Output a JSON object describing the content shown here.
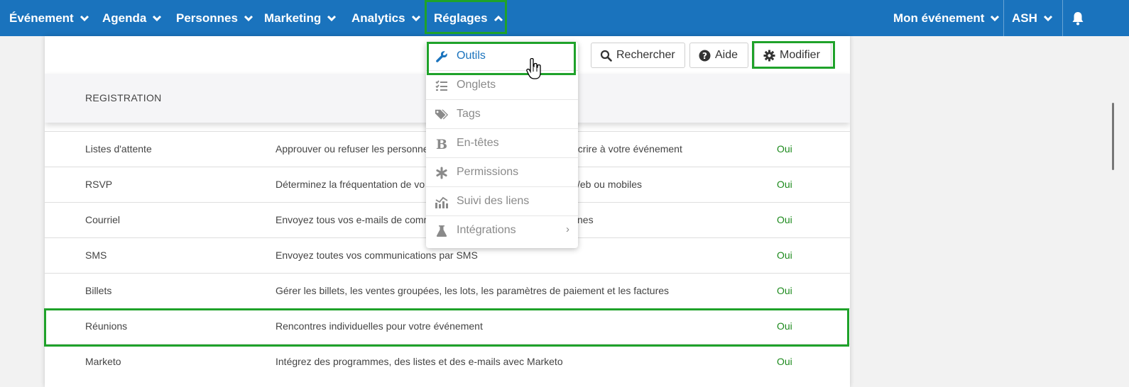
{
  "nav": {
    "items": [
      {
        "label": "Événement"
      },
      {
        "label": "Agenda"
      },
      {
        "label": "Personnes"
      },
      {
        "label": "Marketing"
      },
      {
        "label": "Analytics"
      },
      {
        "label": "Réglages"
      }
    ],
    "right": {
      "event_label": "Mon événement",
      "user_label": "ASH",
      "bell_icon": "bell-icon"
    }
  },
  "toolbar": {
    "search_label": "Rechercher",
    "help_label": "Aide",
    "edit_label": "Modifier"
  },
  "settings_menu": {
    "items": [
      {
        "label": "Outils",
        "icon": "wrench-icon",
        "active": true
      },
      {
        "label": "Onglets",
        "icon": "checklist-icon"
      },
      {
        "label": "Tags",
        "icon": "tags-icon"
      },
      {
        "label": "En-têtes",
        "icon": "bold-icon"
      },
      {
        "label": "Permissions",
        "icon": "asterisk-icon"
      },
      {
        "label": "Suivi des liens",
        "icon": "chart-icon"
      },
      {
        "label": "Intégrations",
        "icon": "flask-icon",
        "submenu": "›"
      }
    ]
  },
  "section": {
    "title": "REGISTRATION"
  },
  "table": {
    "rows": [
      {
        "name": "Listes d'attente",
        "description": "Approuver ou refuser les personne",
        "description_end": "nscrire à votre événement",
        "status": "Oui"
      },
      {
        "name": "RSVP",
        "description": "Déterminez la fréquentation de vo",
        "description_end": "/eb ou mobiles",
        "status": "Oui"
      },
      {
        "name": "Courriel",
        "description": "Envoyez tous vos e-mails de comm",
        "description_end": "nes",
        "status": "Oui"
      },
      {
        "name": "SMS",
        "description": "Envoyez toutes vos communications par SMS",
        "description_end": "",
        "status": "Oui"
      },
      {
        "name": "Billets",
        "description": "Gérer les billets, les ventes groupées, les lots, les paramètres de paiement et les factures",
        "description_end": "",
        "status": "Oui"
      },
      {
        "name": "Réunions",
        "description": "Rencontres individuelles pour votre événement",
        "description_end": "",
        "status": "Oui"
      },
      {
        "name": "Marketo",
        "description": "Intégrez des programmes, des listes et des e-mails avec Marketo",
        "description_end": "",
        "status": "Oui"
      }
    ]
  },
  "colors": {
    "nav_bg": "#1a73bd",
    "highlight": "#1fa22a",
    "status_green": "#1d8a1d"
  }
}
